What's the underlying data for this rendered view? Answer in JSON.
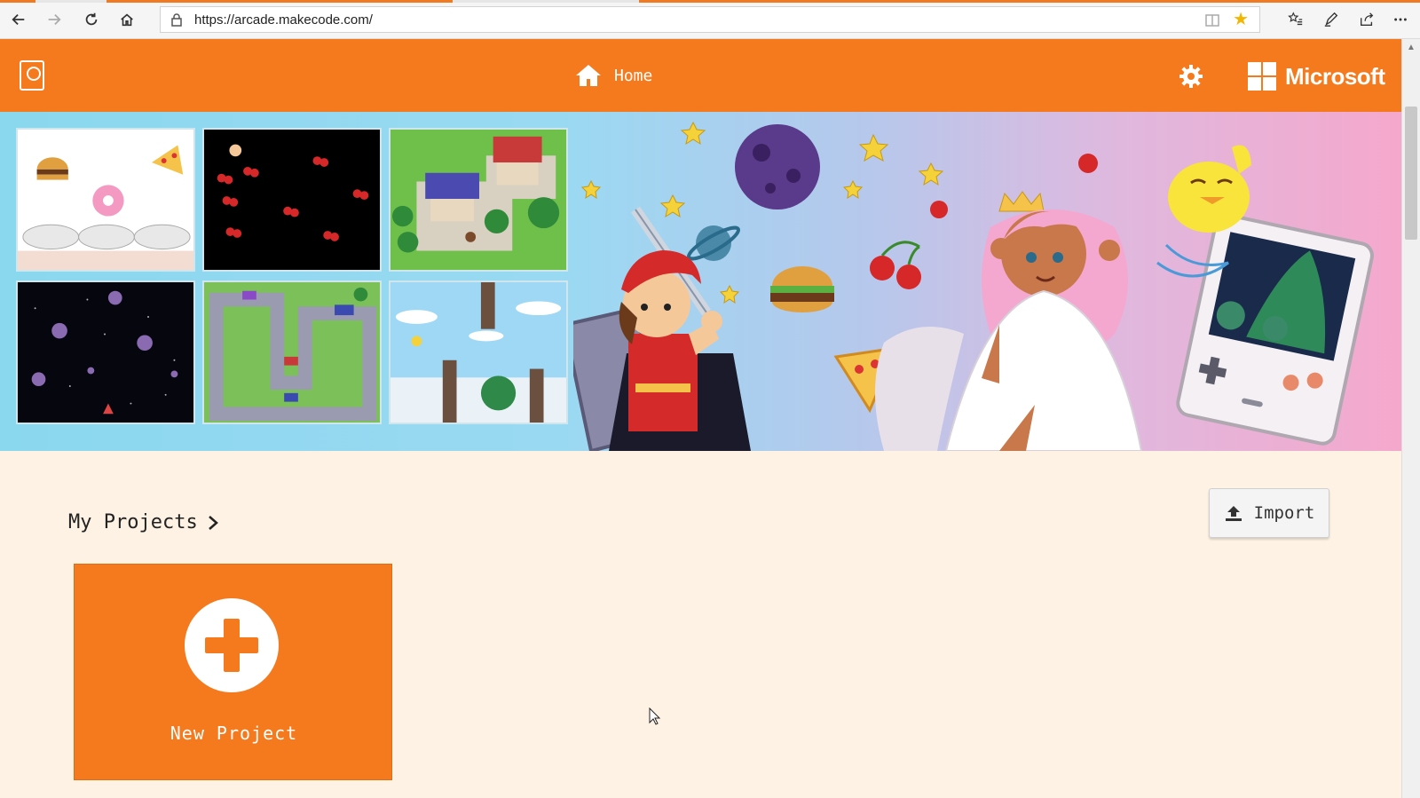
{
  "browser": {
    "url": "https://arcade.makecode.com/"
  },
  "header": {
    "home_label": "Home",
    "brand_label": "Microsoft",
    "color": "#f57a1e"
  },
  "hero": {
    "tiles": [
      {
        "icon": "food-game-thumbnail"
      },
      {
        "icon": "cherries-game-thumbnail"
      },
      {
        "icon": "village-game-thumbnail"
      },
      {
        "icon": "asteroids-game-thumbnail"
      },
      {
        "icon": "racing-game-thumbnail"
      },
      {
        "icon": "flappy-game-thumbnail"
      }
    ]
  },
  "projects": {
    "title": "My Projects",
    "import_label": "Import",
    "new_project_label": "New Project"
  }
}
